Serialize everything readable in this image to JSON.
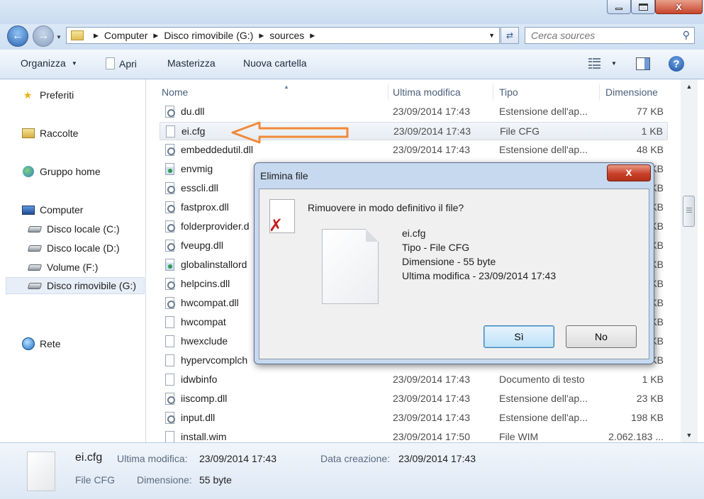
{
  "window": {
    "close_label": "x"
  },
  "address": {
    "crumbs": [
      "Computer",
      "Disco rimovibile (G:)",
      "sources"
    ]
  },
  "search": {
    "placeholder": "Cerca sources"
  },
  "toolbar": {
    "organize": "Organizza",
    "open": "Apri",
    "burn": "Masterizza",
    "new_folder": "Nuova cartella"
  },
  "sidebar": {
    "favorites": "Preferiti",
    "libraries": "Raccolte",
    "homegroup": "Gruppo home",
    "computer": "Computer",
    "drives": [
      "Disco locale (C:)",
      "Disco locale (D:)",
      "Volume (F:)",
      "Disco rimovibile (G:)"
    ],
    "network": "Rete"
  },
  "columns": {
    "name": "Nome",
    "modified": "Ultima modifica",
    "type": "Tipo",
    "size": "Dimensione"
  },
  "files": [
    {
      "name": "du.dll",
      "date": "23/09/2014 17:43",
      "type": "Estensione dell'ap...",
      "size": "77 KB",
      "icon": "dll"
    },
    {
      "name": "ei.cfg",
      "date": "23/09/2014 17:43",
      "type": "File CFG",
      "size": "1 KB",
      "icon": "doc"
    },
    {
      "name": "embeddedutil.dll",
      "date": "23/09/2014 17:43",
      "type": "Estensione dell'ap...",
      "size": "48 KB",
      "icon": "dll"
    },
    {
      "name": "envmig",
      "date": "",
      "type": "",
      "size": "KB",
      "icon": "exe"
    },
    {
      "name": "esscli.dll",
      "date": "",
      "type": "",
      "size": "KB",
      "icon": "dll"
    },
    {
      "name": "fastprox.dll",
      "date": "",
      "type": "",
      "size": "KB",
      "icon": "dll"
    },
    {
      "name": "folderprovider.d",
      "date": "",
      "type": "",
      "size": "KB",
      "icon": "dll"
    },
    {
      "name": "fveupg.dll",
      "date": "",
      "type": "",
      "size": "KB",
      "icon": "dll"
    },
    {
      "name": "globalinstallord",
      "date": "",
      "type": "",
      "size": "KB",
      "icon": "exe"
    },
    {
      "name": "helpcins.dll",
      "date": "",
      "type": "",
      "size": "KB",
      "icon": "dll"
    },
    {
      "name": "hwcompat.dll",
      "date": "",
      "type": "",
      "size": "KB",
      "icon": "dll"
    },
    {
      "name": "hwcompat",
      "date": "",
      "type": "",
      "size": "KB",
      "icon": "doc"
    },
    {
      "name": "hwexclude",
      "date": "",
      "type": "",
      "size": "KB",
      "icon": "doc"
    },
    {
      "name": "hypervcomplch",
      "date": "",
      "type": "",
      "size": "KB",
      "icon": "doc"
    },
    {
      "name": "idwbinfo",
      "date": "23/09/2014 17:43",
      "type": "Documento di testo",
      "size": "1 KB",
      "icon": "doc"
    },
    {
      "name": "iiscomp.dll",
      "date": "23/09/2014 17:43",
      "type": "Estensione dell'ap...",
      "size": "23 KB",
      "icon": "dll"
    },
    {
      "name": "input.dll",
      "date": "23/09/2014 17:43",
      "type": "Estensione dell'ap...",
      "size": "198 KB",
      "icon": "dll"
    },
    {
      "name": "install.wim",
      "date": "23/09/2014 17:50",
      "type": "File WIM",
      "size": "2.062.183 ...",
      "icon": "doc"
    }
  ],
  "details": {
    "name": "ei.cfg",
    "type": "File CFG",
    "modified_label": "Ultima modifica:",
    "modified": "23/09/2014 17:43",
    "size_label": "Dimensione:",
    "size": "55 byte",
    "created_label": "Data creazione:",
    "created": "23/09/2014 17:43"
  },
  "dialog": {
    "title": "Elimina file",
    "question": "Rimuovere in modo definitivo il file?",
    "file_name": "ei.cfg",
    "file_type": "Tipo - File CFG",
    "file_size": "Dimensione - 55 byte",
    "file_modified": "Ultima modifica - 23/09/2014 17:43",
    "yes": "Sì",
    "no": "No"
  },
  "colors": {
    "accent_arrow": "#f08a3a",
    "selection": "#e7ecf2",
    "close_red": "#c8402a"
  }
}
